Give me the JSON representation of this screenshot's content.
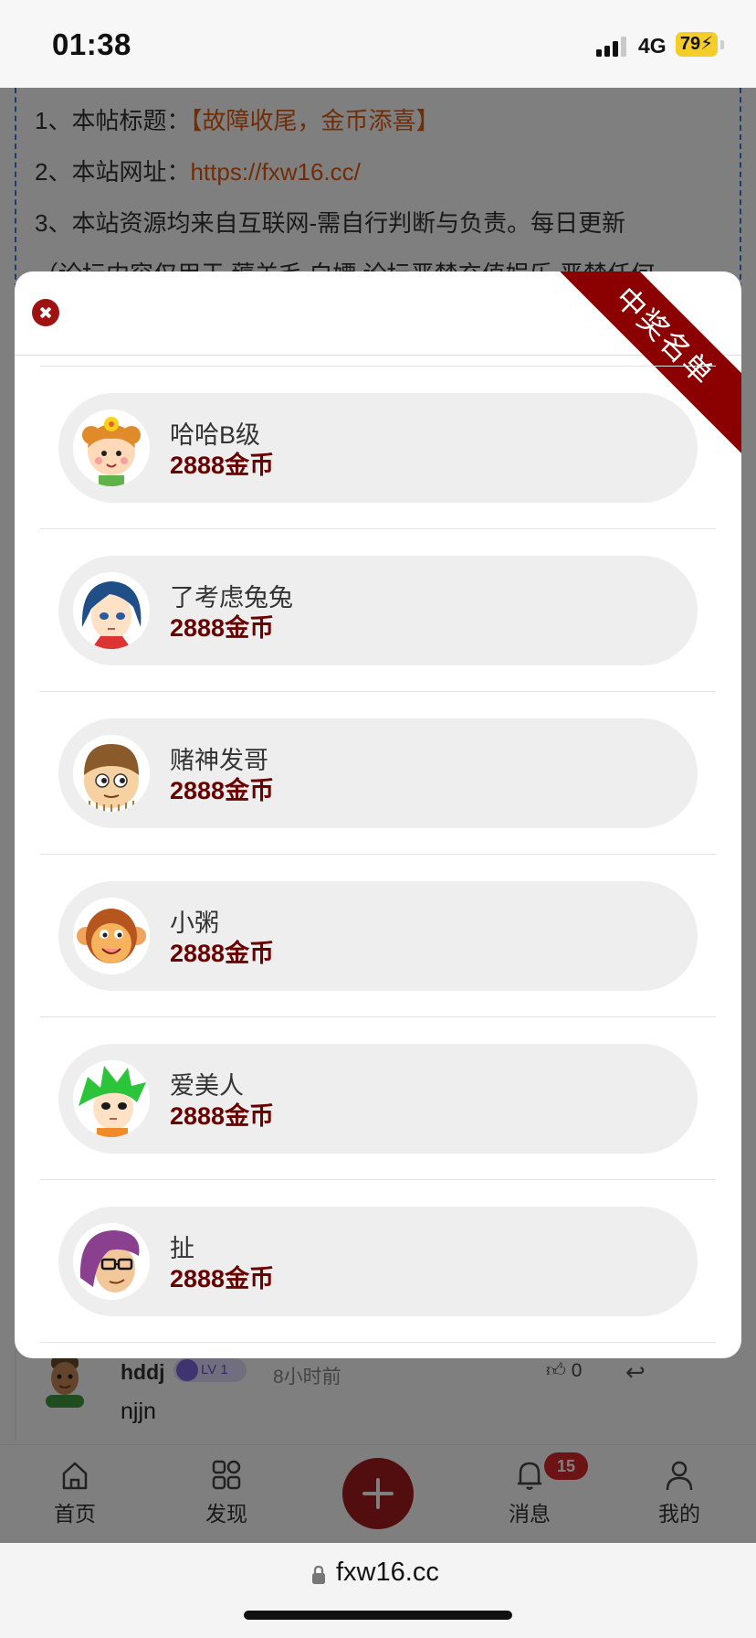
{
  "status": {
    "time": "01:38",
    "network": "4G",
    "battery": "79"
  },
  "notice": {
    "line1_prefix": "1、本帖标题：",
    "line1_value": "【故障收尾，金币添喜】",
    "line2_prefix": "2、本站网址：",
    "line2_value": "https://fxw16.cc/",
    "line3": "3、本站资源均来自互联网-需自行判断与负责。每日更新",
    "line4": "（论坛内容仅用于 薅羊毛 白嫖 论坛严禁充值娱乐 严禁任何"
  },
  "modal": {
    "ribbon": "中奖名单",
    "winners": [
      {
        "name": "哈哈B级",
        "amount": "2888金币",
        "avatar": "girl-avatar"
      },
      {
        "name": "了考虑兔兔",
        "amount": "2888金币",
        "avatar": "blue-hair-avatar"
      },
      {
        "name": "赌神发哥",
        "amount": "2888金币",
        "avatar": "bowl-cut-avatar"
      },
      {
        "name": "小粥",
        "amount": "2888金币",
        "avatar": "monkey-avatar"
      },
      {
        "name": "爱美人",
        "amount": "2888金币",
        "avatar": "green-hair-avatar"
      },
      {
        "name": "扯",
        "amount": "2888金币",
        "avatar": "glasses-avatar"
      }
    ]
  },
  "comment": {
    "user": "hddj",
    "level": "LV 1",
    "time": "8小时前",
    "likes": "0",
    "text": "njjn"
  },
  "tabs": {
    "home": "首页",
    "discover": "发现",
    "messages": "消息",
    "messages_badge": "15",
    "mine": "我的"
  },
  "browser": {
    "url": "fxw16.cc"
  },
  "colors": {
    "accent": "#8b0000",
    "amount": "#6b0000",
    "notice_link": "#e05a0c"
  }
}
